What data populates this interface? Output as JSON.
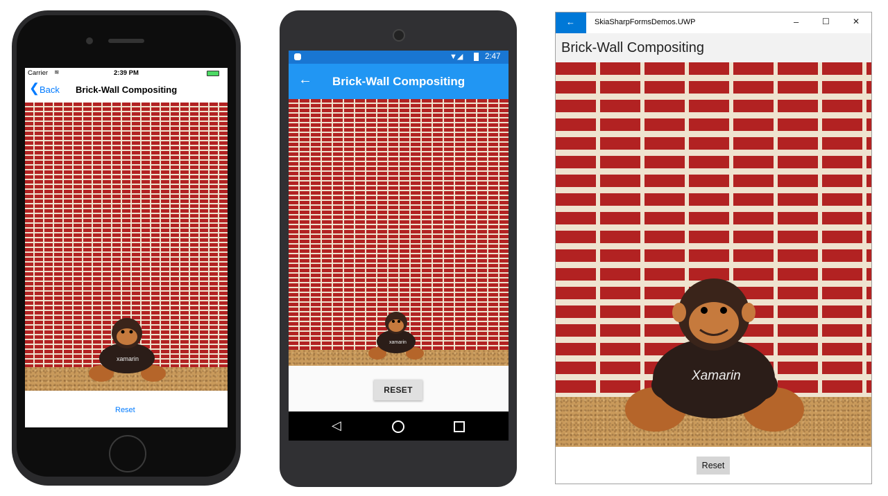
{
  "page_title": "Brick-Wall Compositing",
  "reset_label": "Reset",
  "ios": {
    "carrier": "Carrier",
    "time": "2:39 PM",
    "back_label": "Back"
  },
  "android": {
    "time": "2:47",
    "reset_label": "RESET"
  },
  "uwp": {
    "window_title": "SkiaSharpFormsDemos.UWP",
    "minimize_glyph": "–",
    "maximize_glyph": "☐",
    "close_glyph": "✕"
  },
  "monkey_shirt_text": "Xamarin",
  "monkey_shirt_text_short": "xamarin",
  "colors": {
    "brick": "#b22222",
    "mortar": "#efe3cf",
    "android_blue": "#2196f3",
    "uwp_accent": "#0078d7",
    "ios_blue": "#007aff"
  }
}
